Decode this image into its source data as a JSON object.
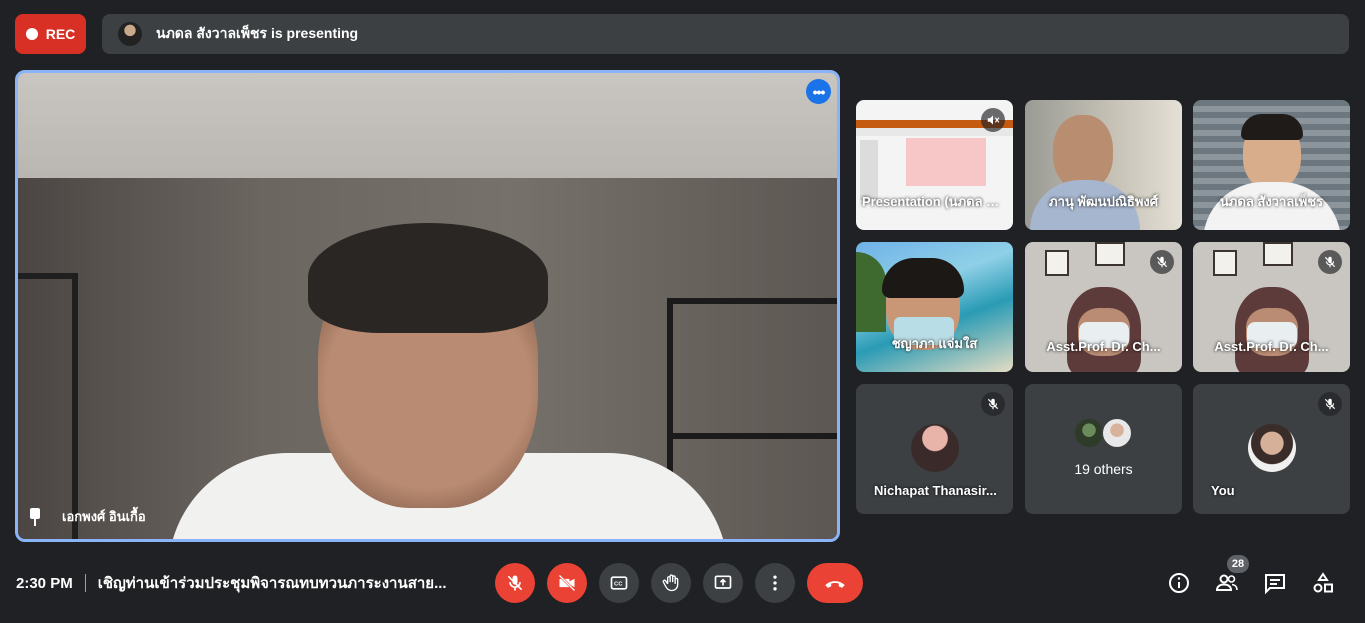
{
  "top": {
    "rec_label": "REC",
    "presenting_text": "นภดล สังวาลเพ็ชร is presenting"
  },
  "main": {
    "participant_name": "เอกพงศ์ อินเกื้อ",
    "more_label": "•••"
  },
  "tiles": [
    {
      "name": "Presentation (นภดล สังวาล...",
      "muted": true
    },
    {
      "name": "ภานุ พัฒนปณิธิพงศ์",
      "muted": false
    },
    {
      "name": "นภดล สังวาลเพ็ชร",
      "muted": false
    },
    {
      "name": "ชญาภา แจ่มใส",
      "muted": false
    },
    {
      "name": "Asst.Prof. Dr. Ch...",
      "muted": true
    },
    {
      "name": "Asst.Prof. Dr. Ch...",
      "muted": true
    },
    {
      "name": "Nichapat Thanasir...",
      "muted": true
    },
    {
      "name": "19 others",
      "muted": false
    },
    {
      "name": "You",
      "muted": true
    }
  ],
  "bottom": {
    "time": "2:30 PM",
    "meeting_title": "เชิญท่านเข้าร่วมประชุมพิจารณทบทวนภาระงานสาย...",
    "participants_count": "28"
  },
  "colors": {
    "background": "#202124",
    "tile": "#3c4043",
    "accent": "#8ab4f8",
    "danger": "#ea4335"
  }
}
